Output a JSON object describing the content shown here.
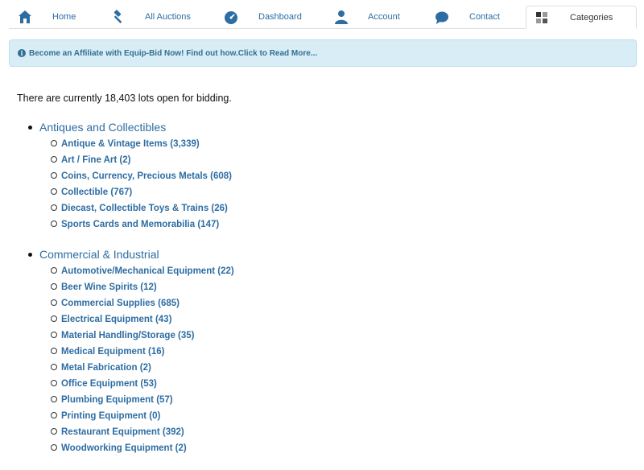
{
  "nav": {
    "tabs": [
      {
        "label": "Home",
        "icon": "home-icon"
      },
      {
        "label": "All Auctions",
        "icon": "gavel-icon"
      },
      {
        "label": "Dashboard",
        "icon": "dashboard-gauge-icon"
      },
      {
        "label": "Account",
        "icon": "user-icon"
      },
      {
        "label": "Contact",
        "icon": "speech-bubble-icon"
      },
      {
        "label": "Categories",
        "icon": "grid-icon"
      }
    ],
    "active_tab": "Categories",
    "icon_color": "#2d6da3"
  },
  "banner": {
    "text": "Become an Affiliate with Equip-Bid Now! Find out how.Click to Read More...",
    "icon": "info-circle-icon",
    "color": "#31708f",
    "background": "#d9edf7"
  },
  "summary": {
    "text": "There are currently 18,403 lots open for bidding."
  },
  "categories": [
    {
      "title": "Antiques and Collectibles",
      "items": [
        "Antique & Vintage Items (3,339)",
        "Art / Fine Art (2)",
        "Coins, Currency, Precious Metals (608)",
        "Collectible (767)",
        "Diecast, Collectible Toys & Trains (26)",
        "Sports Cards and Memorabilia (147)"
      ]
    },
    {
      "title": "Commercial & Industrial",
      "items": [
        "Automotive/Mechanical Equipment (22)",
        "Beer Wine Spirits (12)",
        "Commercial Supplies (685)",
        "Electrical Equipment (43)",
        "Material Handling/Storage (35)",
        "Medical Equipment (16)",
        "Metal Fabrication (2)",
        "Office Equipment (53)",
        "Plumbing Equipment (57)",
        "Printing Equipment (0)",
        "Restaurant Equipment (392)",
        "Woodworking Equipment (2)"
      ]
    }
  ]
}
